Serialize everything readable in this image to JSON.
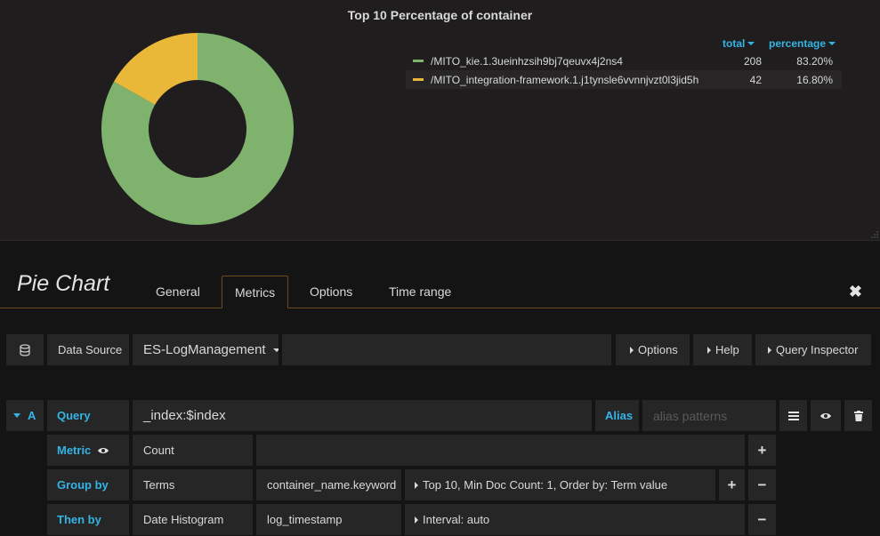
{
  "panel": {
    "title": "Top 10 Percentage of container",
    "legend_header": {
      "total": "total",
      "percentage": "percentage"
    },
    "sort_icon": "caret-down-icon"
  },
  "chart_data": {
    "type": "pie",
    "title": "Top 10 Percentage of container",
    "donut": true,
    "series": [
      {
        "name": "/MITO_kie.1.3ueinhzsih9bj7qeuvx4j2ns4",
        "total": "208",
        "percentage": "83.20%",
        "value": 208,
        "color": "#7eb26d"
      },
      {
        "name": "/MITO_integration-framework.1.j1tynsle6vvnnjvzt0l3jid5h",
        "total": "42",
        "percentage": "16.80%",
        "value": 42,
        "color": "#eab839"
      }
    ]
  },
  "editor": {
    "title": "Pie Chart",
    "tabs": [
      "General",
      "Metrics",
      "Options",
      "Time range"
    ],
    "active_tab": "Metrics",
    "close_icon": "close-icon"
  },
  "datasource": {
    "icon": "database-icon",
    "label": "Data Source",
    "value": "ES-LogManagement",
    "options_btn": "Options",
    "help_btn": "Help",
    "inspector_btn": "Query Inspector"
  },
  "query": {
    "ref": "A",
    "query_label": "Query",
    "query_value": "_index:$index",
    "alias_label": "Alias",
    "alias_placeholder": "alias patterns",
    "metric_label": "Metric",
    "metric_value": "Count",
    "group_label": "Group by",
    "group_type": "Terms",
    "group_field": "container_name.keyword",
    "group_options": "Top 10, Min Doc Count: 1, Order by: Term value",
    "then_label": "Then by",
    "then_type": "Date Histogram",
    "then_field": "log_timestamp",
    "then_options": "Interval: auto"
  },
  "colors": {
    "accent": "#33b5e5",
    "tab_border": "#6b4a1e",
    "panel_bg": "#1f1d1d",
    "cell_bg": "#262626"
  }
}
